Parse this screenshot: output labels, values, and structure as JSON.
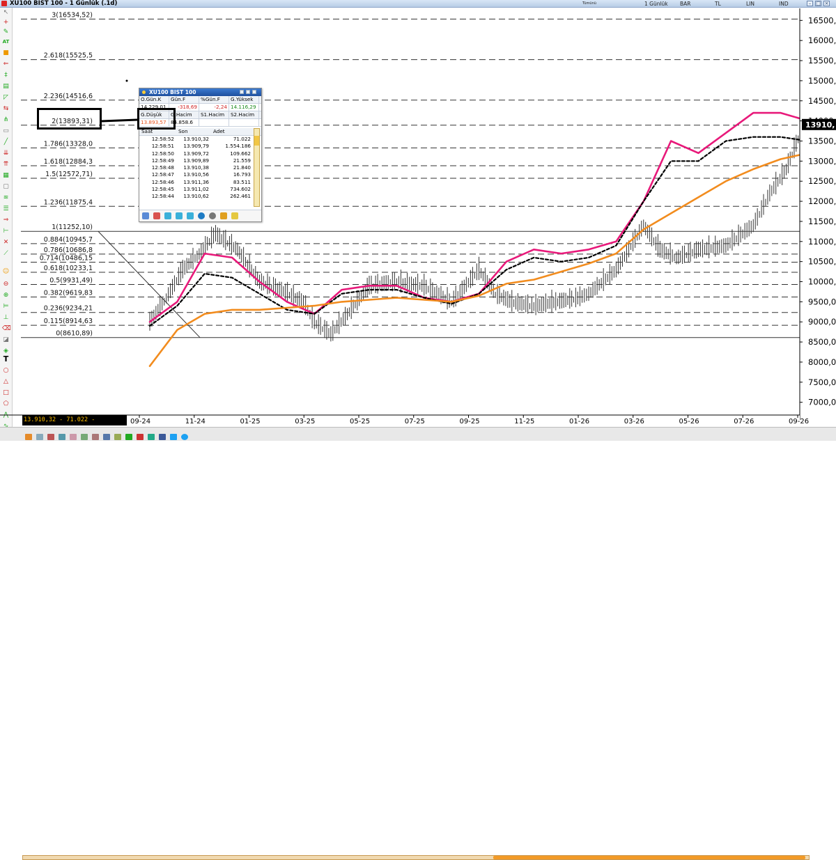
{
  "window": {
    "title": "XU100 BIST 100 - 1 Günlük (.1d)",
    "toolbar": {
      "period": "1 Günlük",
      "chart_style": "BAR",
      "currency": "TL",
      "scale": "LIN",
      "indicator": "IND",
      "small_label": "Tümünü"
    }
  },
  "chart_data": {
    "type": "line",
    "instrument": "XU100 BIST 100",
    "x_ticks": [
      "09-24",
      "11-24",
      "01-25",
      "03-25",
      "05-25",
      "07-25",
      "09-25",
      "11-25",
      "01-26",
      "03-26",
      "05-26",
      "07-26",
      "09-26"
    ],
    "y_ticks": [
      "16500,0",
      "16000,0",
      "15500,0",
      "15000,0",
      "14500,0",
      "14000,0",
      "13500,0",
      "13000,0",
      "12500,0",
      "12000,0",
      "11500,0",
      "11000,0",
      "10500,0",
      "10000,0",
      "9500,0",
      "9000,0",
      "8500,0",
      "8000,0",
      "7500,0",
      "7000,0"
    ],
    "ylim": [
      6700,
      16800
    ],
    "current_price_label": "13910,",
    "fibonacci_levels": [
      {
        "label": "3(16534,52)",
        "value": 16534.52,
        "dashed": true
      },
      {
        "label": "2.618(15525,5",
        "value": 15525.5,
        "dashed": true
      },
      {
        "label": "2.236(14516,6",
        "value": 14516.6,
        "dashed": true
      },
      {
        "label": "2(13893,31)",
        "value": 13893.31,
        "dashed": true
      },
      {
        "label": "1.786(13328,0",
        "value": 13328.0,
        "dashed": true
      },
      {
        "label": "1.618(12884,3",
        "value": 12884.3,
        "dashed": true
      },
      {
        "label": "1.5(12572,71)",
        "value": 12572.71,
        "dashed": true
      },
      {
        "label": "1.236(11875,4",
        "value": 11875.4,
        "dashed": true
      },
      {
        "label": "1(11252,10)",
        "value": 11252.1,
        "dashed": false
      },
      {
        "label": "0.884(10945,7",
        "value": 10945.7,
        "dashed": true
      },
      {
        "label": "0.786(10686,8",
        "value": 10686.8,
        "dashed": true
      },
      {
        "label": "0.714(10486,15",
        "value": 10486.15,
        "dashed": true
      },
      {
        "label": "0.618(10233,1",
        "value": 10233.1,
        "dashed": true
      },
      {
        "label": "0.5(9931,49)",
        "value": 9931.49,
        "dashed": true
      },
      {
        "label": "0.382(9619,83",
        "value": 9619.83,
        "dashed": true
      },
      {
        "label": "0.236(9234,21",
        "value": 9234.21,
        "dashed": true
      },
      {
        "label": "0.115(8914,63",
        "value": 8914.63,
        "dashed": true
      },
      {
        "label": "0(8610,89)",
        "value": 8610.89,
        "dashed": false
      }
    ],
    "series": [
      {
        "color": "#000000",
        "style": "bar",
        "x": [
          0,
          0.3,
          0.6,
          0.9,
          1.2,
          1.6,
          2.0,
          2.4,
          2.8,
          3.0,
          3.3,
          3.6,
          4.0,
          4.5,
          5.0,
          5.5,
          6.0,
          6.3,
          6.6,
          7.0,
          7.4,
          7.8,
          8.0,
          8.5,
          9.0,
          9.3,
          9.6,
          10.0,
          10.5,
          11.0,
          11.3,
          11.6,
          12.0,
          12.3,
          12.6
        ],
        "values": [
          9000,
          9600,
          10300,
          10700,
          11200,
          10800,
          10000,
          9800,
          9500,
          9000,
          8700,
          9200,
          9900,
          10000,
          9900,
          9500,
          10300,
          9700,
          9500,
          9400,
          9500,
          9600,
          9700,
          10300,
          11400,
          10800,
          10600,
          10800,
          10900,
          11400,
          12200,
          12800,
          14200,
          13000,
          12800
        ]
      },
      {
        "color": "#e8197a",
        "style": "solid",
        "x": [
          0,
          0.5,
          1.0,
          1.5,
          2.0,
          2.5,
          3.0,
          3.5,
          4.0,
          4.5,
          5.0,
          5.5,
          6.0,
          6.5,
          7.0,
          7.5,
          8.0,
          8.5,
          9.0,
          9.5,
          10.0,
          10.5,
          11.0,
          11.5,
          12.0,
          12.4,
          12.7
        ],
        "values": [
          9000,
          9500,
          10700,
          10600,
          10000,
          9500,
          9200,
          9800,
          9900,
          9900,
          9600,
          9500,
          9700,
          10500,
          10800,
          10700,
          10800,
          11000,
          12000,
          13500,
          13200,
          13700,
          14200,
          14200,
          14000,
          14100,
          14000
        ]
      },
      {
        "color": "#000000",
        "style": "dashed",
        "x": [
          0,
          0.5,
          1.0,
          1.5,
          2.0,
          2.5,
          3.0,
          3.5,
          4.0,
          4.5,
          5.0,
          5.5,
          6.0,
          6.5,
          7.0,
          7.5,
          8.0,
          8.5,
          9.0,
          9.5,
          10.0,
          10.5,
          11.0,
          11.5,
          12.0,
          12.4,
          12.7
        ],
        "values": [
          8900,
          9400,
          10200,
          10100,
          9700,
          9300,
          9200,
          9700,
          9800,
          9800,
          9600,
          9450,
          9700,
          10300,
          10600,
          10500,
          10600,
          10900,
          12000,
          13000,
          13000,
          13500,
          13600,
          13600,
          13500,
          13700,
          13800
        ]
      },
      {
        "color": "#f28c1e",
        "style": "solid",
        "x": [
          0,
          0.5,
          1.0,
          1.5,
          2.0,
          2.5,
          3.0,
          3.5,
          4.0,
          4.5,
          5.0,
          5.5,
          6.0,
          6.5,
          7.0,
          7.5,
          8.0,
          8.5,
          9.0,
          9.5,
          10.0,
          10.5,
          11.0,
          11.5,
          12.0,
          12.4,
          12.7
        ],
        "values": [
          7900,
          8800,
          9200,
          9300,
          9300,
          9350,
          9400,
          9500,
          9550,
          9600,
          9550,
          9500,
          9650,
          9950,
          10050,
          10250,
          10450,
          10700,
          11300,
          11700,
          12100,
          12500,
          12800,
          13050,
          13200,
          13250,
          13320
        ]
      }
    ],
    "grid": false,
    "legend": "none"
  },
  "highlight": {
    "fib_label": "2(13893,31)",
    "low_label": "G.Düşük",
    "low_value": "13.893,57"
  },
  "popup": {
    "title": "XU100 BIST 100",
    "headers_top": [
      "O.Gün.K",
      "Gün.F",
      "%Gün.F",
      "G.Yüksek"
    ],
    "values_top": [
      "14.229,01",
      "-318,69",
      "-2,24",
      "14.116,29"
    ],
    "headers_mid": [
      "G.Düşük",
      "G.Hacim",
      "S1.Hacim",
      "S2.Hacim"
    ],
    "values_mid": [
      "13.893,57",
      "84.858.6",
      "",
      ""
    ],
    "trade_headers": [
      "Saat",
      "Son",
      "Adet"
    ],
    "trades": [
      [
        "12:58:52",
        "13.910,32",
        "71.022"
      ],
      [
        "12:58:51",
        "13.909,79",
        "1.554.186"
      ],
      [
        "12:58:50",
        "13.909,72",
        "109.662"
      ],
      [
        "12:58:49",
        "13.909,89",
        "21.559"
      ],
      [
        "12:58:48",
        "13.910,38",
        "21.840"
      ],
      [
        "12:58:47",
        "13.910,56",
        "16.793"
      ],
      [
        "12:58:46",
        "13.911,36",
        "83.511"
      ],
      [
        "12:58:45",
        "13.911,02",
        "734.602"
      ],
      [
        "12:58:44",
        "13.910,62",
        "262.461"
      ]
    ]
  },
  "status": {
    "last_text": "13.910,32 - 71.022 - 12:58:52"
  },
  "colors": {
    "positive": "#1a8a1a",
    "negative": "#d22222",
    "highlight_value": "#e8531e",
    "status_text": "#ffbf00"
  }
}
